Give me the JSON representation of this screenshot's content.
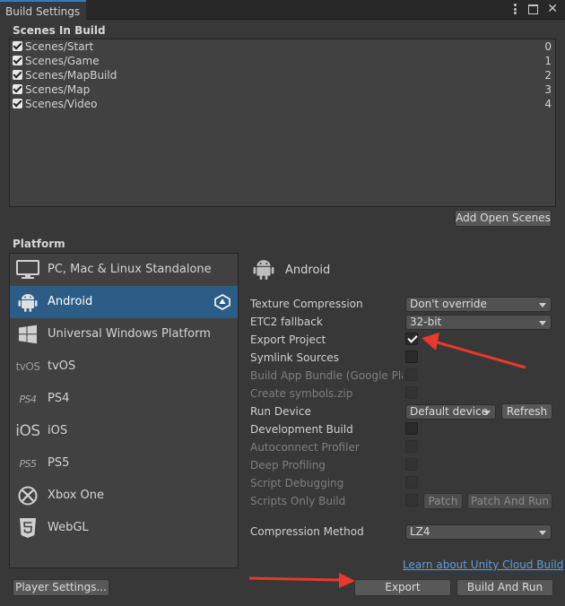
{
  "window": {
    "tab_title": "Build Settings"
  },
  "scenes": {
    "title": "Scenes In Build",
    "items": [
      {
        "name": "Scenes/Start",
        "index": "0"
      },
      {
        "name": "Scenes/Game",
        "index": "1"
      },
      {
        "name": "Scenes/MapBuild",
        "index": "2"
      },
      {
        "name": "Scenes/Map",
        "index": "3"
      },
      {
        "name": "Scenes/Video",
        "index": "4"
      }
    ],
    "add_open_scenes_label": "Add Open Scenes"
  },
  "platform": {
    "title": "Platform",
    "items": [
      {
        "label": "PC, Mac & Linux Standalone",
        "icon": "monitor-icon"
      },
      {
        "label": "Android",
        "icon": "android-icon",
        "selected": true
      },
      {
        "label": "Universal Windows Platform",
        "icon": "windows-icon"
      },
      {
        "label": "tvOS",
        "icon": "tvos-icon",
        "icon_text": "tvOS"
      },
      {
        "label": "PS4",
        "icon": "ps4-icon",
        "icon_text": "PS4"
      },
      {
        "label": "iOS",
        "icon": "ios-icon",
        "icon_text": "iOS"
      },
      {
        "label": "PS5",
        "icon": "ps5-icon",
        "icon_text": "PS5"
      },
      {
        "label": "Xbox One",
        "icon": "xbox-icon"
      },
      {
        "label": "WebGL",
        "icon": "html5-icon"
      }
    ]
  },
  "settings": {
    "platform_name": "Android",
    "texture_compression": {
      "label": "Texture Compression",
      "value": "Don't override"
    },
    "etc2_fallback": {
      "label": "ETC2 fallback",
      "value": "32-bit"
    },
    "export_project": {
      "label": "Export Project",
      "checked": true
    },
    "symlink_sources": {
      "label": "Symlink Sources",
      "checked": false
    },
    "build_app_bundle": {
      "label": "Build App Bundle (Google Play)",
      "checked": false,
      "disabled": true
    },
    "create_symbols": {
      "label": "Create symbols.zip",
      "checked": false,
      "disabled": true
    },
    "run_device": {
      "label": "Run Device",
      "value": "Default device",
      "refresh_label": "Refresh"
    },
    "development_build": {
      "label": "Development Build",
      "checked": false
    },
    "autoconnect_profiler": {
      "label": "Autoconnect Profiler",
      "disabled": true
    },
    "deep_profiling": {
      "label": "Deep Profiling",
      "disabled": true
    },
    "script_debugging": {
      "label": "Script Debugging",
      "disabled": true
    },
    "scripts_only_build": {
      "label": "Scripts Only Build",
      "disabled": true,
      "patch_label": "Patch",
      "patch_and_run_label": "Patch And Run"
    },
    "compression_method": {
      "label": "Compression Method",
      "value": "LZ4"
    },
    "cloud_build_link": "Learn about Unity Cloud Build"
  },
  "footer": {
    "player_settings_label": "Player Settings...",
    "export_label": "Export",
    "build_and_run_label": "Build And Run"
  },
  "colors": {
    "background": "#383838",
    "selected": "#2c5d87",
    "link": "#5a9fe0",
    "annotation_arrow": "#e8392a"
  }
}
